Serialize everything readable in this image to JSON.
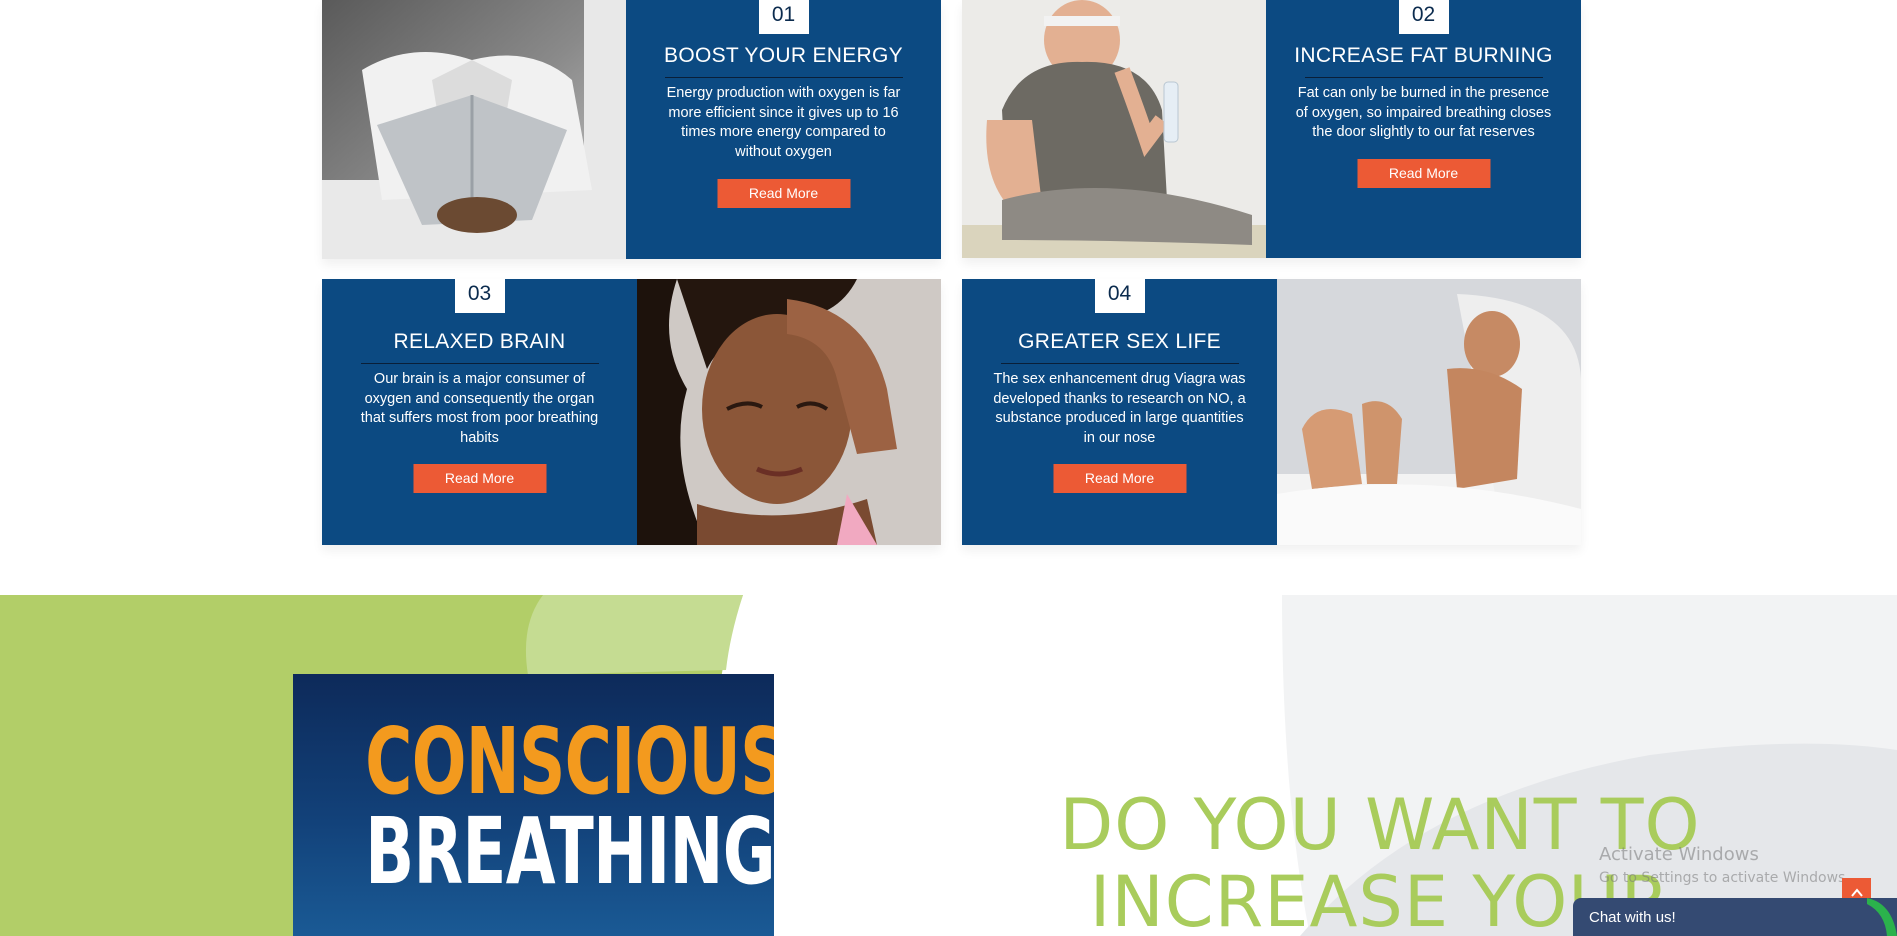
{
  "cards": [
    {
      "number": "01",
      "title": "BOOST YOUR ENERGY",
      "text": "Energy production with oxygen is far more efficient since it gives up to 16 times more energy compared to without oxygen",
      "button": "Read More",
      "photo": "man-head-under-laptop"
    },
    {
      "number": "02",
      "title": "INCREASE FAT BURNING",
      "text": "Fat can only be burned in the presence of oxygen, so impaired breathing closes the door slightly to our fat reserves",
      "button": "Read More",
      "photo": "overweight-man-with-water-bottle"
    },
    {
      "number": "03",
      "title": "RELAXED BRAIN",
      "text": "Our brain is a major consumer of oxygen and consequently the organ that suffers most from poor breathing habits",
      "button": "Read More",
      "photo": "woman-hand-on-forehead"
    },
    {
      "number": "04",
      "title": "GREATER SEX LIFE",
      "text": "The sex enhancement drug Viagra was developed thanks to research on NO, a substance produced in large quantities in our nose",
      "button": "Read More",
      "photo": "man-in-bed-under-sheet"
    }
  ],
  "book": {
    "line1": "CONSCIOUS",
    "line2": "BREATHING"
  },
  "headline": {
    "line1": "DO YOU WANT TO",
    "line2": "INCREASE YOUR"
  },
  "watermark": {
    "title": "Activate Windows",
    "subtitle": "Go to Settings to activate Windows."
  },
  "chat": {
    "label": "Chat with us!"
  },
  "colors": {
    "panel_blue": "#0c4a82",
    "button_orange": "#ec5a35",
    "accent_green": "#a9cc5c",
    "book_orange": "#f39a1e"
  }
}
